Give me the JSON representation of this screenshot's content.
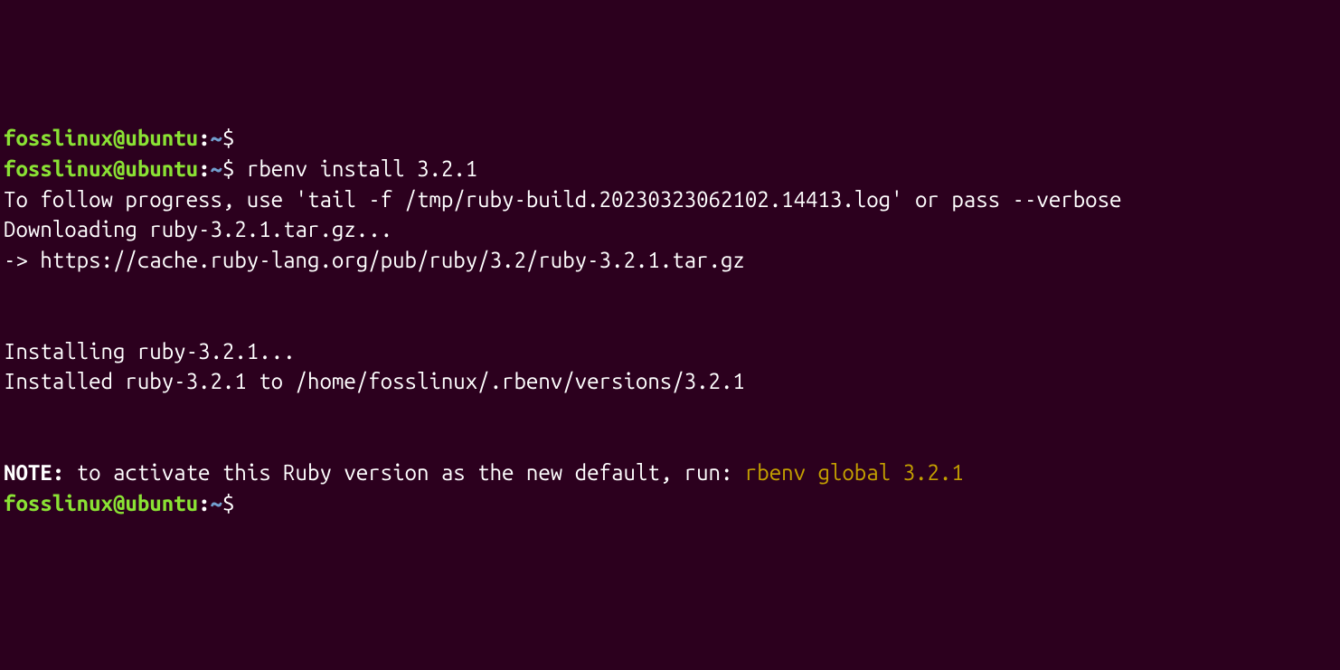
{
  "prompt": {
    "user": "fosslinux",
    "at": "@",
    "host": "ubuntu",
    "colon": ":",
    "path": "~",
    "dollar": "$"
  },
  "lines": {
    "cmd1": "",
    "cmd2": "rbenv install 3.2.1",
    "out1": "To follow progress, use 'tail -f /tmp/ruby-build.20230323062102.14413.log' or pass --verbose",
    "out2": "Downloading ruby-3.2.1.tar.gz...",
    "out3": "-> https://cache.ruby-lang.org/pub/ruby/3.2/ruby-3.2.1.tar.gz",
    "out4": "Installing ruby-3.2.1...",
    "out5": "Installed ruby-3.2.1 to /home/fosslinux/.rbenv/versions/3.2.1",
    "note_label": "NOTE:",
    "note_text": " to activate this Ruby version as the new default, run: ",
    "note_hl": "rbenv global 3.2.1"
  }
}
